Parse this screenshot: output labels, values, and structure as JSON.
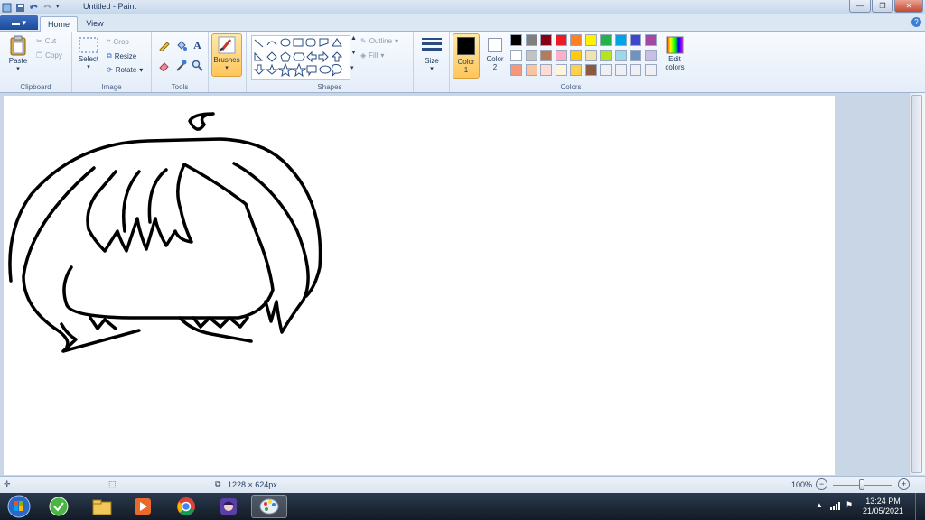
{
  "window": {
    "title": "Untitled - Paint"
  },
  "tabs": {
    "file": "▬ ▾",
    "home": "Home",
    "view": "View"
  },
  "clipboard": {
    "label": "Clipboard",
    "paste": "Paste",
    "cut": "Cut",
    "copy": "Copy"
  },
  "image": {
    "label": "Image",
    "select": "Select",
    "crop": "Crop",
    "resize": "Resize",
    "rotate": "Rotate"
  },
  "tools": {
    "label": "Tools"
  },
  "brushes": {
    "label": "Brushes"
  },
  "shapes": {
    "label": "Shapes",
    "outline": "Outline",
    "fill": "Fill"
  },
  "size": {
    "label": "Size"
  },
  "colors": {
    "label": "Colors",
    "color1": "Color 1",
    "color2": "Color 2",
    "edit": "Edit colors",
    "color1_value": "#000000",
    "color2_value": "#ffffff",
    "palette_row1": [
      "#000000",
      "#7f7f7f",
      "#880015",
      "#ed1c24",
      "#ff7f27",
      "#fff200",
      "#22b14c",
      "#00a2e8",
      "#3f48cc",
      "#a349a4"
    ],
    "palette_row2": [
      "#ffffff",
      "#c3c3c3",
      "#b97a57",
      "#ffaec9",
      "#ffc90e",
      "#efe4b0",
      "#b5e61d",
      "#99d9ea",
      "#7092be",
      "#c8bfe7"
    ],
    "palette_row3": [
      "#f7977a",
      "#fbc4a0",
      "#fddcd5",
      "#fef6dc",
      "#fcd04d",
      "#8c5a3c",
      "#eef0f3",
      "#eef0f3",
      "#eef0f3",
      "#eef0f3"
    ]
  },
  "status": {
    "dimensions": "1228 × 624px",
    "zoom": "100%"
  },
  "clock": {
    "time": "13:24 PM",
    "date": "21/05/2021"
  }
}
